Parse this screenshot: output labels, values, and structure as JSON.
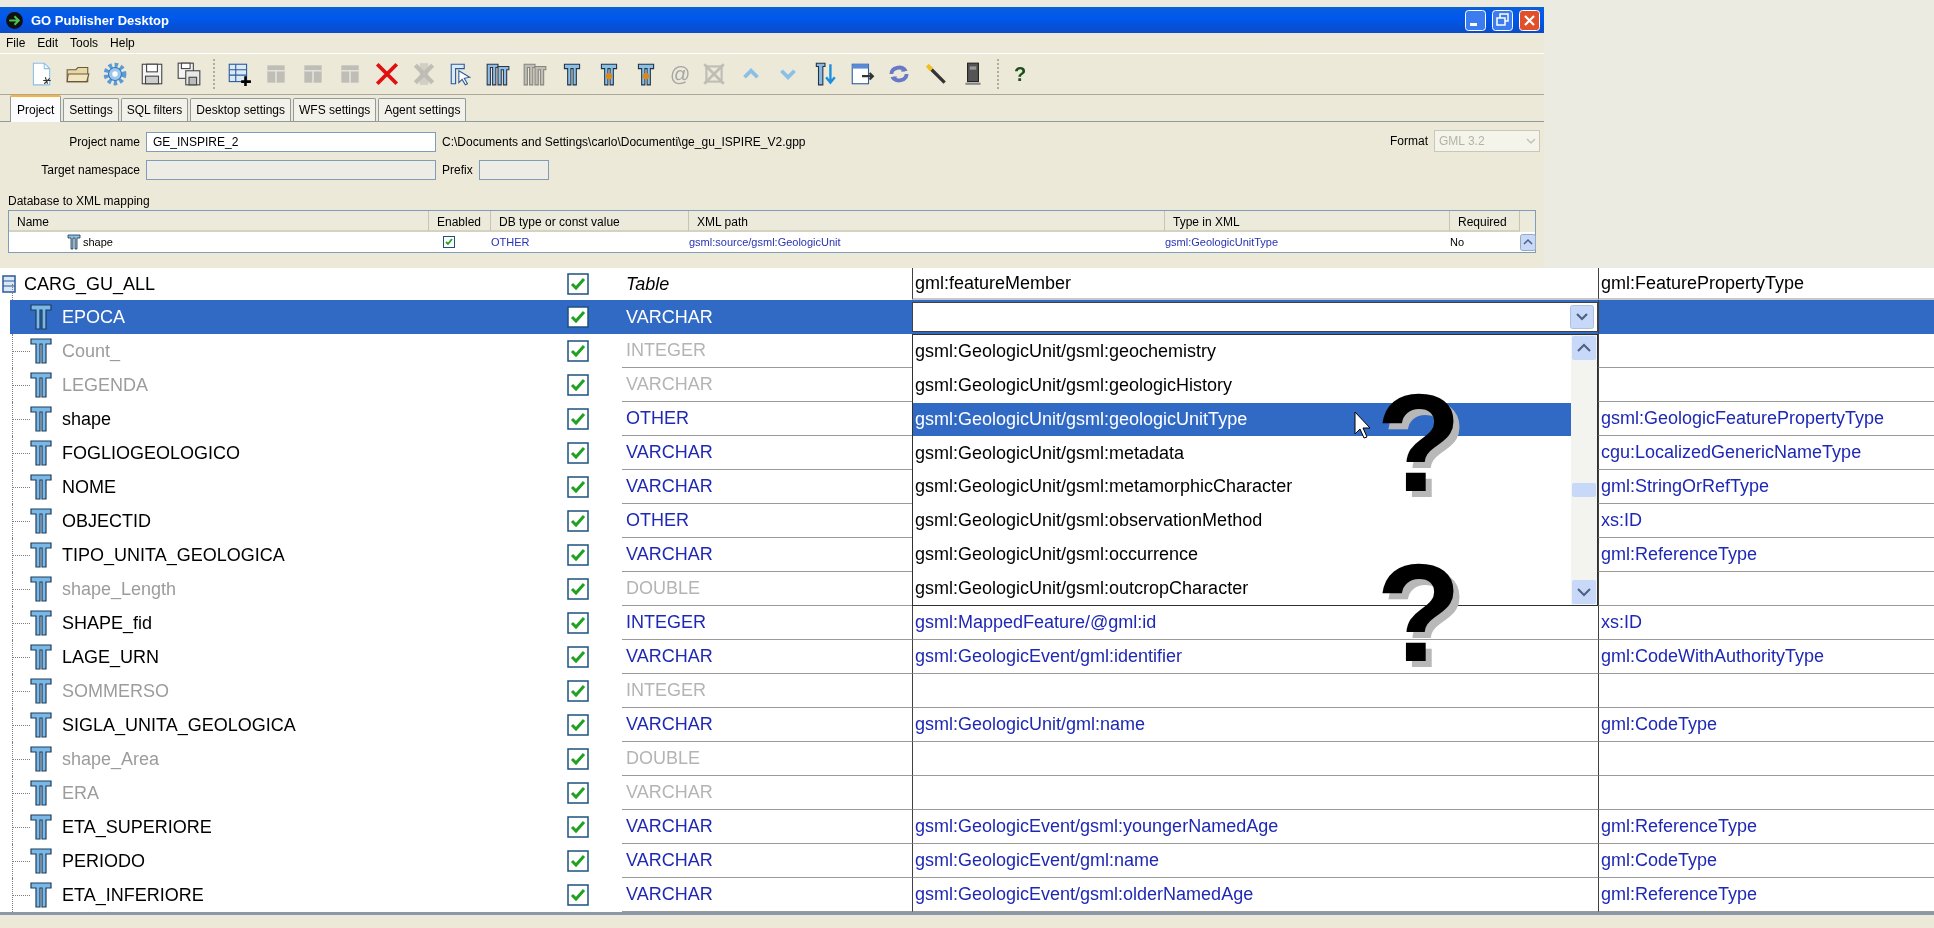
{
  "window": {
    "title": "GO Publisher Desktop"
  },
  "menu": [
    "File",
    "Edit",
    "Tools",
    "Help"
  ],
  "toolbar": [
    {
      "kind": "new-file",
      "disabled": false
    },
    {
      "kind": "folder",
      "disabled": false
    },
    {
      "kind": "gear",
      "disabled": false
    },
    {
      "kind": "save",
      "disabled": false
    },
    {
      "kind": "save-as",
      "disabled": false
    },
    {
      "kind": "separator"
    },
    {
      "kind": "table-add",
      "disabled": false
    },
    {
      "kind": "table",
      "disabled": true
    },
    {
      "kind": "table",
      "disabled": true
    },
    {
      "kind": "table",
      "disabled": true
    },
    {
      "kind": "delete",
      "disabled": false
    },
    {
      "kind": "column-delete",
      "disabled": true
    },
    {
      "kind": "select",
      "disabled": false
    },
    {
      "kind": "column-pair",
      "disabled": false
    },
    {
      "kind": "column-pair",
      "disabled": true
    },
    {
      "kind": "column",
      "disabled": false
    },
    {
      "kind": "column-mark",
      "disabled": false
    },
    {
      "kind": "column-mark",
      "disabled": false
    },
    {
      "kind": "at",
      "label": "@",
      "disabled": true
    },
    {
      "kind": "cross-box",
      "disabled": true
    },
    {
      "kind": "up",
      "disabled": false
    },
    {
      "kind": "down",
      "disabled": false
    },
    {
      "kind": "column-down",
      "disabled": false
    },
    {
      "kind": "export",
      "disabled": false
    },
    {
      "kind": "refresh",
      "disabled": false
    },
    {
      "kind": "wand",
      "disabled": false
    },
    {
      "kind": "device",
      "disabled": false
    },
    {
      "kind": "separator"
    },
    {
      "kind": "help",
      "label": "?",
      "disabled": false
    }
  ],
  "tabs": [
    {
      "label": "Project",
      "selected": true
    },
    {
      "label": "Settings",
      "selected": false
    },
    {
      "label": "SQL filters",
      "selected": false
    },
    {
      "label": "Desktop settings",
      "selected": false
    },
    {
      "label": "WFS settings",
      "selected": false
    },
    {
      "label": "Agent settings",
      "selected": false
    }
  ],
  "project": {
    "name_label": "Project name",
    "name_value": "GE_INSPIRE_2",
    "path": "C:\\Documents and Settings\\carlo\\Documenti\\ge_gu_ISPIRE_V2.gpp",
    "format_label": "Format",
    "format_value": "GML 3.2",
    "format_disabled": true,
    "namespace_label": "Target namespace",
    "prefix_label": "Prefix"
  },
  "mapping": {
    "title": "Database to XML mapping",
    "columns": [
      "Name",
      "Enabled",
      "DB type or const value",
      "XML path",
      "Type in XML",
      "Required"
    ],
    "rows": [
      {
        "name": "shape",
        "enabled": true,
        "type": "OTHER",
        "xml_path": "gsml:source/gsml:GeologicUnit",
        "type_in_xml": "gsml:GeologicUnitType",
        "required": "No"
      }
    ]
  },
  "zoomed_mapping": {
    "root": {
      "name": "CARG_GU_ALL",
      "enabled": true,
      "type": "Table",
      "xml_path": "gml:featureMember",
      "type_in_xml": "gml:FeaturePropertyType",
      "selected": false,
      "children": [
        {
          "name": "EPOCA",
          "enabled": true,
          "type": "VARCHAR",
          "disabled": false,
          "selected": true,
          "editing": true
        },
        {
          "name": "Count_",
          "enabled": true,
          "type": "INTEGER",
          "disabled": true,
          "selected": false
        },
        {
          "name": "LEGENDA",
          "enabled": true,
          "type": "VARCHAR",
          "disabled": true,
          "selected": false
        },
        {
          "name": "shape",
          "enabled": true,
          "type": "OTHER",
          "disabled": false,
          "selected": false,
          "type_in_xml": "gsml:GeologicFeaturePropertyType"
        },
        {
          "name": "FOGLIOGEOLOGICO",
          "enabled": true,
          "type": "VARCHAR",
          "disabled": false,
          "selected": false,
          "type_in_xml": "cgu:LocalizedGenericNameType"
        },
        {
          "name": "NOME",
          "enabled": true,
          "type": "VARCHAR",
          "disabled": false,
          "selected": false,
          "type_in_xml": "gml:StringOrRefType"
        },
        {
          "name": "OBJECTID",
          "enabled": true,
          "type": "OTHER",
          "disabled": false,
          "selected": false,
          "type_in_xml": "xs:ID"
        },
        {
          "name": "TIPO_UNITA_GEOLOGICA",
          "enabled": true,
          "type": "VARCHAR",
          "disabled": false,
          "selected": false,
          "type_in_xml": "gml:ReferenceType"
        },
        {
          "name": "shape_Length",
          "enabled": true,
          "type": "DOUBLE",
          "disabled": true,
          "selected": false
        },
        {
          "name": "SHAPE_fid",
          "enabled": true,
          "type": "INTEGER",
          "disabled": false,
          "selected": false,
          "xml_path": "gsml:MappedFeature/@gml:id",
          "type_in_xml": "xs:ID"
        },
        {
          "name": "LAGE_URN",
          "enabled": true,
          "type": "VARCHAR",
          "disabled": false,
          "selected": false,
          "xml_path": "gsml:GeologicEvent/gml:identifier",
          "type_in_xml": "gml:CodeWithAuthorityType"
        },
        {
          "name": "SOMMERSO",
          "enabled": true,
          "type": "INTEGER",
          "disabled": true,
          "selected": false
        },
        {
          "name": "SIGLA_UNITA_GEOLOGICA",
          "enabled": true,
          "type": "VARCHAR",
          "disabled": false,
          "selected": false,
          "xml_path": "gsml:GeologicUnit/gml:name",
          "type_in_xml": "gml:CodeType"
        },
        {
          "name": "shape_Area",
          "enabled": true,
          "type": "DOUBLE",
          "disabled": true,
          "selected": false
        },
        {
          "name": "ERA",
          "enabled": true,
          "type": "VARCHAR",
          "disabled": true,
          "selected": false
        },
        {
          "name": "ETA_SUPERIORE",
          "enabled": true,
          "type": "VARCHAR",
          "disabled": false,
          "selected": false,
          "xml_path": "gsml:GeologicEvent/gsml:youngerNamedAge",
          "type_in_xml": "gml:ReferenceType"
        },
        {
          "name": "PERIODO",
          "enabled": true,
          "type": "VARCHAR",
          "disabled": false,
          "selected": false,
          "xml_path": "gsml:GeologicEvent/gml:name",
          "type_in_xml": "gml:CodeType"
        },
        {
          "name": "ETA_INFERIORE",
          "enabled": true,
          "type": "VARCHAR",
          "disabled": false,
          "selected": false,
          "xml_path": "gsml:GeologicEvent/gsml:olderNamedAge",
          "type_in_xml": "gml:ReferenceType"
        }
      ]
    },
    "dropdown": {
      "items": [
        {
          "label": "gsml:GeologicUnit/gsml:geochemistry",
          "selected": false
        },
        {
          "label": "gsml:GeologicUnit/gsml:geologicHistory",
          "selected": false
        },
        {
          "label": "gsml:GeologicUnit/gsml:geologicUnitType",
          "selected": true
        },
        {
          "label": "gsml:GeologicUnit/gsml:metadata",
          "selected": false
        },
        {
          "label": "gsml:GeologicUnit/gsml:metamorphicCharacter",
          "selected": false
        },
        {
          "label": "gsml:GeologicUnit/gsml:observationMethod",
          "selected": false
        },
        {
          "label": "gsml:GeologicUnit/gsml:occurrence",
          "selected": false
        },
        {
          "label": "gsml:GeologicUnit/gsml:outcropCharacter",
          "selected": false
        }
      ]
    }
  },
  "annotations": [
    "?",
    "?"
  ]
}
